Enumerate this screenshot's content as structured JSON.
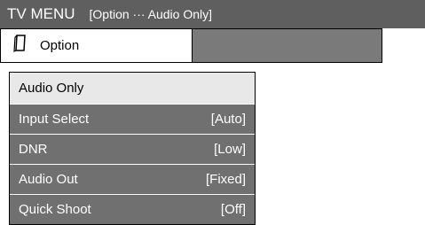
{
  "title": {
    "main": "TV MENU",
    "path": "[Option ··· Audio Only]"
  },
  "tab": {
    "icon": "remote-icon",
    "label": "Option"
  },
  "menu": {
    "items": [
      {
        "label": "Audio Only",
        "value": ""
      },
      {
        "label": "Input Select",
        "value": "[Auto]"
      },
      {
        "label": "DNR",
        "value": "[Low]"
      },
      {
        "label": "Audio Out",
        "value": "[Fixed]"
      },
      {
        "label": "Quick Shoot",
        "value": "[Off]"
      }
    ]
  },
  "colors": {
    "title_bg": "#5f5f5f",
    "item_bg": "#707070",
    "selected_bg": "#e8e8e8",
    "tab_empty_bg": "#7a7a7a"
  }
}
